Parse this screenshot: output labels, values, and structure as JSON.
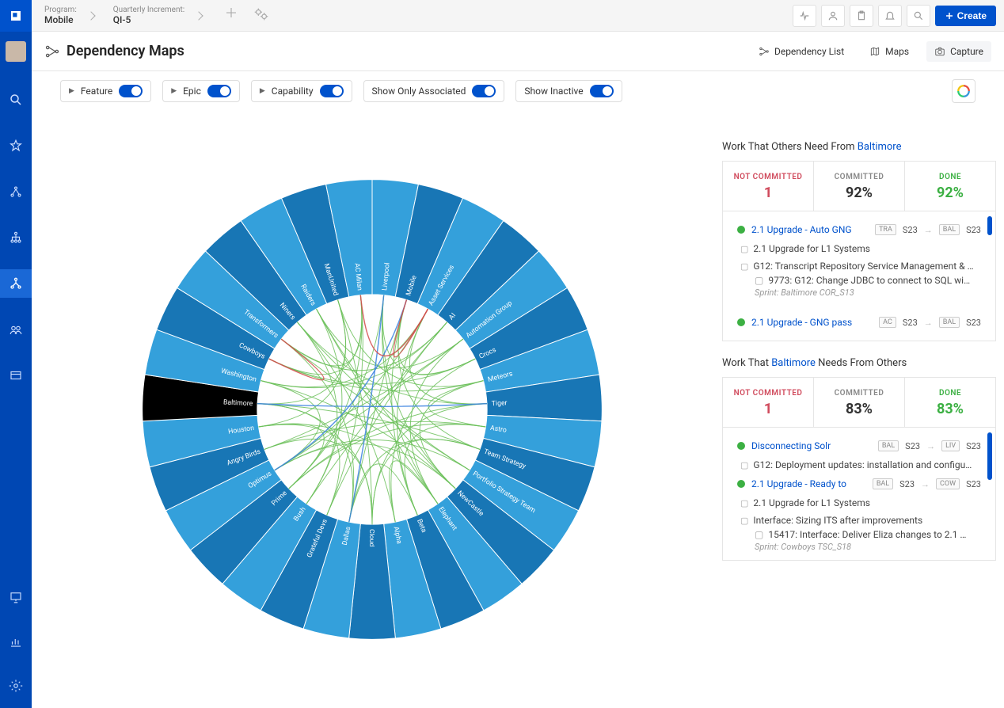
{
  "breadcrumb": {
    "program_label": "Program:",
    "program_value": "Mobile",
    "qi_label": "Quarterly Increment:",
    "qi_value": "QI-5"
  },
  "create_label": "Create",
  "page_title": "Dependency Maps",
  "title_actions": {
    "dep_list": "Dependency List",
    "maps": "Maps",
    "capture": "Capture"
  },
  "filters": {
    "feature": "Feature",
    "epic": "Epic",
    "capability": "Capability",
    "show_assoc": "Show Only Associated",
    "show_inactive": "Show Inactive"
  },
  "panel": {
    "section1_prefix": "Work That Others Need From ",
    "section1_link": "Baltimore",
    "section2_prefix": "Work That ",
    "section2_link": "Baltimore",
    "section2_suffix": " Needs From Others",
    "stats_labels": {
      "nc": "NOT COMMITTED",
      "cm": "COMMITTED",
      "dn": "DONE"
    },
    "stats1": {
      "nc": "1",
      "cm": "92%",
      "dn": "92%"
    },
    "stats2": {
      "nc": "1",
      "cm": "83%",
      "dn": "83%"
    },
    "list1": {
      "item1": {
        "title": "2.1 Upgrade - Auto GNG",
        "tag1": "TRA",
        "s1": "S23",
        "tag2": "BAL",
        "s2": "S23"
      },
      "sub1a": "2.1 Upgrade for L1 Systems",
      "sub1b": "G12: Transcript Repository Service Management & …",
      "sub1c": "9773: G12: Change JDBC to connect to SQL wi…",
      "sprint1": "Sprint: Baltimore COR_S13",
      "item2": {
        "title": "2.1 Upgrade - GNG pass",
        "tag1": "AC",
        "s1": "S23",
        "tag2": "BAL",
        "s2": "S23"
      }
    },
    "list2": {
      "item1": {
        "title": "Disconnecting Solr",
        "tag1": "BAL",
        "s1": "S23",
        "tag2": "LIV",
        "s2": "S23"
      },
      "sub1a": "G12: Deployment updates: installation and configu…",
      "item2": {
        "title": "2.1 Upgrade - Ready to",
        "tag1": "BAL",
        "s1": "S23",
        "tag2": "COW",
        "s2": "S23"
      },
      "sub2a": "2.1 Upgrade for L1 Systems",
      "sub2b": "Interface: Sizing ITS after improvements",
      "sub2c": "15417: Interface: Deliver Eliza changes to 2.1 …",
      "sprint2": "Sprint: Cowboys TSC_S18"
    }
  },
  "chart_data": {
    "type": "chord",
    "selected": "Baltimore",
    "nodes": [
      "Liverpool",
      "Mobile",
      "Asset Services",
      "AI",
      "Automation Group",
      "Crocs",
      "Meteors",
      "Tiger",
      "Astro",
      "Team Strategy",
      "Portfolio Strategy Team",
      "NewCastle",
      "Elephant",
      "Beta",
      "Alpha",
      "Cloud",
      "Dallas",
      "Grateful Devs",
      "Bush",
      "Prime",
      "Optimus",
      "Angry Birds",
      "Houston",
      "Baltimore",
      "Washington",
      "Cowboys",
      "Transformers",
      "Niners",
      "Raiders",
      "ManUnited",
      "AC Milan"
    ],
    "colors": {
      "ring_dark": "#1876b5",
      "ring_light": "#34a0db",
      "selected": "#000000",
      "chord_green": "#6bbf59",
      "chord_blue": "#3b82e0",
      "chord_red": "#d44a4a"
    }
  }
}
